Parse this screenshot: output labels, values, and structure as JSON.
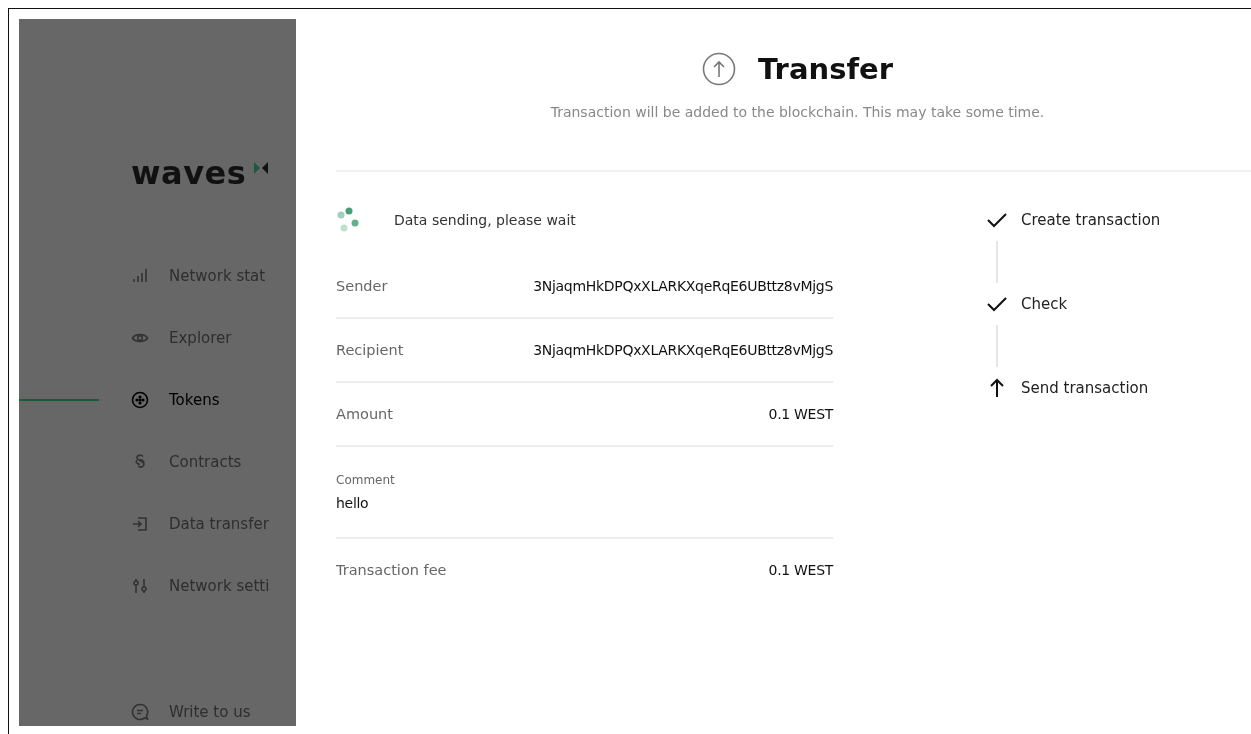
{
  "sidebar": {
    "logo": "waves",
    "items": [
      {
        "label": "Network stat",
        "kind": "bars",
        "selected": false
      },
      {
        "label": "Explorer",
        "kind": "eye",
        "selected": false
      },
      {
        "label": "Tokens",
        "kind": "token",
        "selected": true
      },
      {
        "label": "Contracts",
        "kind": "section",
        "selected": false
      },
      {
        "label": "Data transfer",
        "kind": "login",
        "selected": false
      },
      {
        "label": "Network setti",
        "kind": "sliders",
        "selected": false
      }
    ],
    "footer_item": {
      "label": "Write to us",
      "kind": "chat",
      "selected": false
    }
  },
  "dialog": {
    "title": "Transfer",
    "subtitle": "Transaction will be added to the blockchain. This may take some time.",
    "status": "Data sending, please wait",
    "rows": [
      {
        "kind": "inline",
        "label": "Sender",
        "value": "3NjaqmHkDPQxXLARKXqeRqE6UBttz8vMjgS"
      },
      {
        "kind": "inline",
        "label": "Recipient",
        "value": "3NjaqmHkDPQxXLARKXqeRqE6UBttz8vMjgS"
      },
      {
        "kind": "inline",
        "label": "Amount",
        "value": "0.1 WEST"
      },
      {
        "kind": "stacked",
        "label": "Comment",
        "value": "hello"
      },
      {
        "kind": "inline",
        "label": "Transaction fee",
        "value": "0.1 WEST"
      }
    ],
    "steps": [
      {
        "label": "Create transaction",
        "kind": "done"
      },
      {
        "label": "Check",
        "kind": "done"
      },
      {
        "label": "Send transaction",
        "kind": "current"
      }
    ]
  }
}
